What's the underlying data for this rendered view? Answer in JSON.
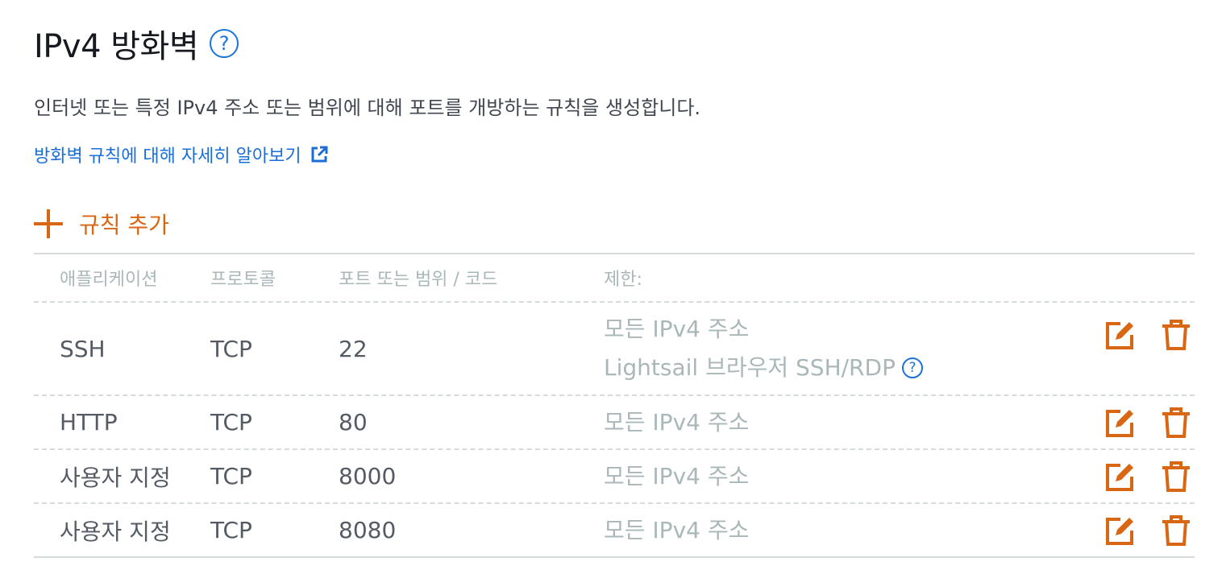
{
  "header": {
    "title": "IPv4 방화벽",
    "help_icon": "question-circle-icon",
    "description": "인터넷 또는 특정 IPv4 주소 또는 범위에 대해 포트를 개방하는 규칙을 생성합니다.",
    "learn_more_label": "방화벽 규칙에 대해 자세히 알아보기",
    "learn_more_icon": "external-link-icon"
  },
  "add_rule": {
    "label": "규칙 추가",
    "icon": "plus-icon",
    "color": "#d86613"
  },
  "table": {
    "columns": [
      "애플리케이션",
      "프로토콜",
      "포트 또는 범위 / 코드",
      "제한:"
    ],
    "rows": [
      {
        "application": "SSH",
        "protocol": "TCP",
        "port": "22",
        "restriction": "모든 IPv4 주소",
        "restriction_extra": "Lightsail 브라우저 SSH/RDP"
      },
      {
        "application": "HTTP",
        "protocol": "TCP",
        "port": "80",
        "restriction": "모든 IPv4 주소"
      },
      {
        "application": "사용자 지정",
        "protocol": "TCP",
        "port": "8000",
        "restriction": "모든 IPv4 주소"
      },
      {
        "application": "사용자 지정",
        "protocol": "TCP",
        "port": "8080",
        "restriction": "모든 IPv4 주소"
      }
    ],
    "row_actions": [
      "edit-icon",
      "trash-icon"
    ]
  },
  "colors": {
    "accent": "#d86613",
    "link": "#1a6ed8",
    "muted": "#aab7b8"
  }
}
